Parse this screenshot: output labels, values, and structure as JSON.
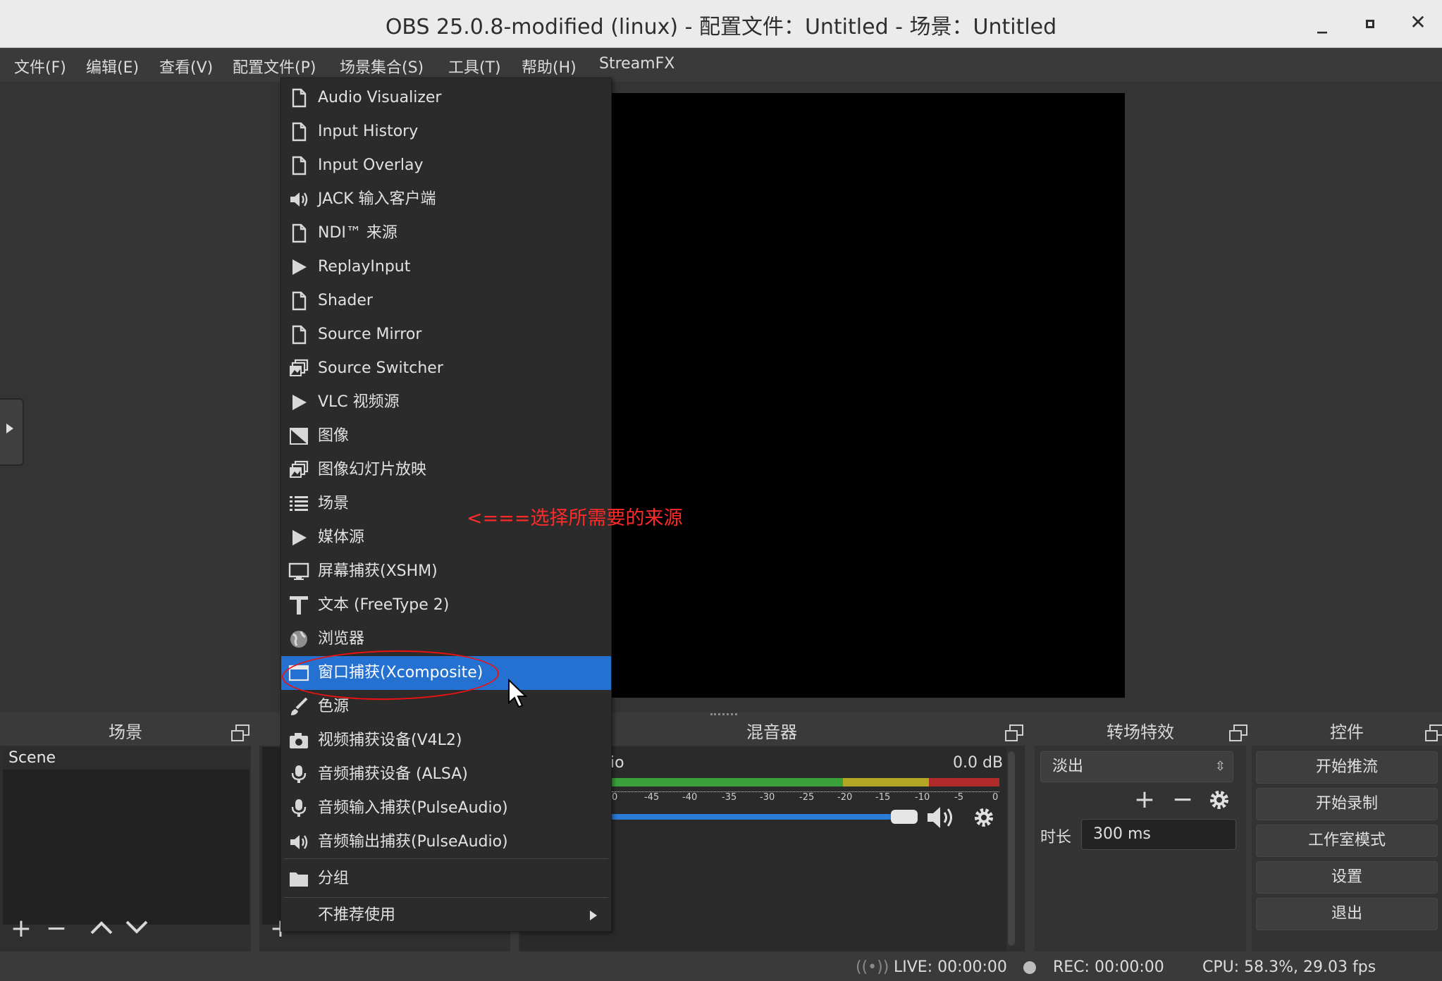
{
  "window": {
    "title": "OBS 25.0.8-modified (linux) - 配置文件：Untitled - 场景：Untitled",
    "min_glyph": "_",
    "max_glyph": "▫",
    "close_glyph": "✕"
  },
  "menubar": {
    "items": [
      "文件(F)",
      "编辑(E)",
      "查看(V)",
      "配置文件(P)",
      "场景集合(S)",
      "工具(T)",
      "帮助(H)",
      "StreamFX"
    ]
  },
  "context_menu": {
    "items": [
      {
        "label": "Audio Visualizer",
        "icon": "file-icon"
      },
      {
        "label": "Input History",
        "icon": "file-icon"
      },
      {
        "label": "Input Overlay",
        "icon": "file-icon"
      },
      {
        "label": "JACK 输入客户端",
        "icon": "speaker-icon"
      },
      {
        "label": "NDI™ 来源",
        "icon": "file-icon"
      },
      {
        "label": "ReplayInput",
        "icon": "play-icon"
      },
      {
        "label": "Shader",
        "icon": "file-icon"
      },
      {
        "label": "Source Mirror",
        "icon": "file-icon"
      },
      {
        "label": "Source Switcher",
        "icon": "slideshow-icon"
      },
      {
        "label": "VLC 视频源",
        "icon": "play-icon"
      },
      {
        "label": "图像",
        "icon": "image-icon"
      },
      {
        "label": "图像幻灯片放映",
        "icon": "slideshow-icon"
      },
      {
        "label": "场景",
        "icon": "list-icon"
      },
      {
        "label": "媒体源",
        "icon": "play-icon"
      },
      {
        "label": "屏幕捕获(XSHM)",
        "icon": "monitor-icon"
      },
      {
        "label": "文本 (FreeType 2)",
        "icon": "text-icon"
      },
      {
        "label": "浏览器",
        "icon": "globe-icon"
      },
      {
        "label": "窗口捕获(Xcomposite)",
        "icon": "window-icon",
        "selected": true
      },
      {
        "label": "色源",
        "icon": "brush-icon"
      },
      {
        "label": "视频捕获设备(V4L2)",
        "icon": "camera-icon"
      },
      {
        "label": "音频捕获设备 (ALSA)",
        "icon": "mic-icon"
      },
      {
        "label": "音频输入捕获(PulseAudio)",
        "icon": "mic-icon"
      },
      {
        "label": "音频输出捕获(PulseAudio)",
        "icon": "speaker-icon"
      }
    ],
    "group_label": "分组",
    "deprecated_label": "不推荐使用"
  },
  "annotation": "<===选择所需要的来源",
  "docks": {
    "scenes": {
      "title": "场景",
      "items": [
        "Scene"
      ]
    },
    "mixer": {
      "title": "混音器",
      "source_partial": "io",
      "level": "0.0 dB",
      "ticks": [
        "0",
        "-45",
        "-40",
        "-35",
        "-30",
        "-25",
        "-20",
        "-15",
        "-10",
        "-5",
        "0"
      ]
    },
    "transitions": {
      "title": "转场特效",
      "selected": "淡出",
      "duration_label": "时长",
      "duration_value": "300 ms"
    },
    "controls": {
      "title": "控件",
      "buttons": [
        "开始推流",
        "开始录制",
        "工作室模式",
        "设置",
        "退出"
      ]
    }
  },
  "statusbar": {
    "live": "LIVE: 00:00:00",
    "rec": "REC: 00:00:00",
    "cpu": "CPU: 58.3%, 29.03 fps"
  },
  "colors": {
    "selection": "#2471d2",
    "annotation": "#ff2a2a",
    "meter_green": "#3aa03a",
    "meter_yellow": "#b3a726",
    "meter_red": "#b02a2a"
  }
}
